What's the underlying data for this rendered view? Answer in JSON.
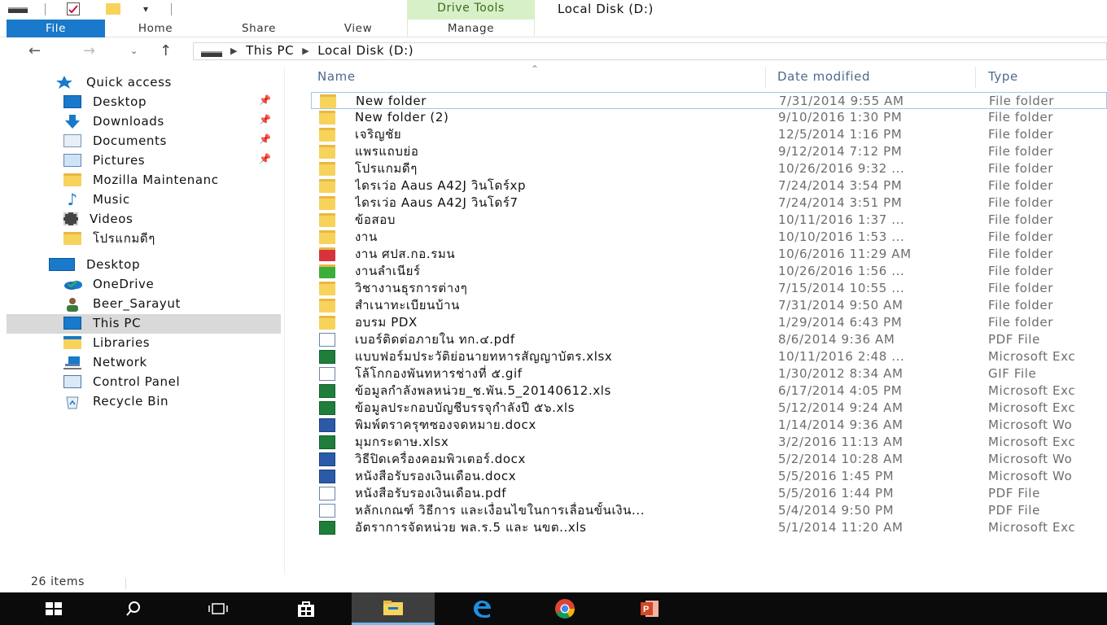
{
  "window": {
    "title": "Local Disk (D:)",
    "contextual_tab_group": "Drive Tools"
  },
  "ribbon": {
    "tabs": [
      "File",
      "Home",
      "Share",
      "View",
      "Manage"
    ]
  },
  "address": {
    "crumbs": [
      "This PC",
      "Local Disk (D:)"
    ]
  },
  "nav_pane": {
    "quick_access": "Quick access",
    "items": [
      {
        "label": "Desktop",
        "icon": "desktop-icon",
        "pinned": true
      },
      {
        "label": "Downloads",
        "icon": "download-arrow-icon",
        "pinned": true
      },
      {
        "label": "Documents",
        "icon": "documents-icon",
        "pinned": true
      },
      {
        "label": "Pictures",
        "icon": "pictures-icon",
        "pinned": true
      },
      {
        "label": "Mozilla Maintenanc",
        "icon": "folder-icon",
        "pinned": false
      },
      {
        "label": "Music",
        "icon": "music-note-icon",
        "pinned": false
      },
      {
        "label": "Videos",
        "icon": "film-icon",
        "pinned": false
      },
      {
        "label": "โปรแกมดีๆ",
        "icon": "folder-icon",
        "pinned": false
      }
    ],
    "desktop": "Desktop",
    "tree": [
      {
        "label": "OneDrive",
        "icon": "onedrive-cloud-icon"
      },
      {
        "label": "Beer_Sarayut",
        "icon": "user-icon"
      },
      {
        "label": "This PC",
        "icon": "computer-icon",
        "selected": true
      },
      {
        "label": "Libraries",
        "icon": "libraries-icon"
      },
      {
        "label": "Network",
        "icon": "network-icon"
      },
      {
        "label": "Control Panel",
        "icon": "control-panel-icon"
      },
      {
        "label": "Recycle Bin",
        "icon": "recycle-bin-icon"
      }
    ]
  },
  "columns": {
    "name": "Name",
    "date": "Date modified",
    "type": "Type"
  },
  "files": [
    {
      "name": "New folder",
      "date": "7/31/2014 9:55 AM",
      "type": "File folder",
      "icon": "folder"
    },
    {
      "name": "New folder (2)",
      "date": "9/10/2016 1:30 PM",
      "type": "File folder",
      "icon": "folder"
    },
    {
      "name": "เจริญชัย",
      "date": "12/5/2014 1:16 PM",
      "type": "File folder",
      "icon": "folder"
    },
    {
      "name": "แพรแถบย่อ",
      "date": "9/12/2014 7:12 PM",
      "type": "File folder",
      "icon": "folder"
    },
    {
      "name": "โปรแกมดีๆ",
      "date": "10/26/2016 9:32 ...",
      "type": "File folder",
      "icon": "folder"
    },
    {
      "name": "ไดรเว่อ Aaus A42J วินโดร์xp",
      "date": "7/24/2014 3:54 PM",
      "type": "File folder",
      "icon": "folder"
    },
    {
      "name": "ไดรเว่อ Aaus A42J วินโดร์7",
      "date": "7/24/2014 3:51 PM",
      "type": "File folder",
      "icon": "folder"
    },
    {
      "name": "ข้อสอบ",
      "date": "10/11/2016 1:37 ...",
      "type": "File folder",
      "icon": "folder"
    },
    {
      "name": "งาน",
      "date": "10/10/2016 1:53 ...",
      "type": "File folder",
      "icon": "folder"
    },
    {
      "name": "งาน ศปส.กอ.รมน",
      "date": "10/6/2016 11:29 AM",
      "type": "File folder",
      "icon": "folder-red"
    },
    {
      "name": "งานลำเนียร์",
      "date": "10/26/2016 1:56 ...",
      "type": "File folder",
      "icon": "folder-green"
    },
    {
      "name": "วิชางานธุรการต่างๆ",
      "date": "7/15/2014 10:55 ...",
      "type": "File folder",
      "icon": "folder"
    },
    {
      "name": "สำเนาทะเบียนบ้าน",
      "date": "7/31/2014 9:50 AM",
      "type": "File folder",
      "icon": "folder"
    },
    {
      "name": "อบรม PDX",
      "date": "1/29/2014 6:43 PM",
      "type": "File folder",
      "icon": "folder"
    },
    {
      "name": "เบอร์ติดต่อภายใน ทก.๔.pdf",
      "date": "8/6/2014 9:36 AM",
      "type": "PDF File",
      "icon": "pdf"
    },
    {
      "name": "แบบฟอร์มประวัติย่อนายทหารสัญญาบัตร.xlsx",
      "date": "10/11/2016 2:48 ...",
      "type": "Microsoft Exc",
      "icon": "xls"
    },
    {
      "name": "โล้โกกองพันทหารช่างที่ ๕.gif",
      "date": "1/30/2012 8:34 AM",
      "type": "GIF File",
      "icon": "gif"
    },
    {
      "name": "ข้อมูลกำลังพลหน่วย_ช.พัน.5_20140612.xls",
      "date": "6/17/2014 4:05 PM",
      "type": "Microsoft Exc",
      "icon": "xls"
    },
    {
      "name": "ข้อมูลประกอบบัญชีบรรจุกำลังปี ๕๖.xls",
      "date": "5/12/2014 9:24 AM",
      "type": "Microsoft Exc",
      "icon": "xls"
    },
    {
      "name": "พิมพ์ตราครุฑซองจดหมาย.docx",
      "date": "1/14/2014 9:36 AM",
      "type": "Microsoft Wo",
      "icon": "word"
    },
    {
      "name": "มุมกระดาษ.xlsx",
      "date": "3/2/2016 11:13 AM",
      "type": "Microsoft Exc",
      "icon": "xls"
    },
    {
      "name": "วิธีปิดเครื่องคอมพิวเตอร์.docx",
      "date": "5/2/2014 10:28 AM",
      "type": "Microsoft Wo",
      "icon": "word"
    },
    {
      "name": "หนังสือรับรองเงินเดือน.docx",
      "date": "5/5/2016 1:45 PM",
      "type": "Microsoft Wo",
      "icon": "word"
    },
    {
      "name": "หนังสือรับรองเงินเดือน.pdf",
      "date": "5/5/2016 1:44 PM",
      "type": "PDF File",
      "icon": "pdf"
    },
    {
      "name": "หลักเกณฑ์ วิธีการ และเงื่อนไขในการเลื่อนขั้นเงิน...",
      "date": "5/4/2014 9:50 PM",
      "type": "PDF File",
      "icon": "pdf"
    },
    {
      "name": "อัตราการจัดหน่วย พล.ร.5 และ นขต..xls",
      "date": "5/1/2014 11:20 AM",
      "type": "Microsoft Exc",
      "icon": "xls"
    }
  ],
  "status": {
    "item_count": "26 items"
  },
  "taskbar": {
    "items": [
      "start-windows-icon",
      "search-icon",
      "task-view-icon",
      "store-icon",
      "file-explorer-icon",
      "edge-icon",
      "chrome-icon",
      "powerpoint-icon"
    ]
  }
}
